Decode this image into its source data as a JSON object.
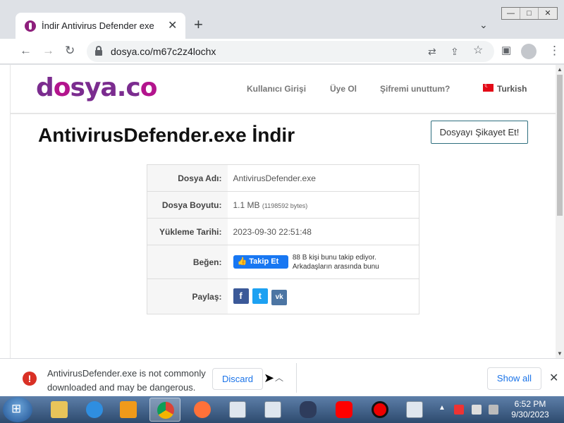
{
  "browser": {
    "tab_title": "İndir Antivirus Defender exe",
    "url": "dosya.co/m67c2z4lochx",
    "win_controls": {
      "minimize": "—",
      "maximize": "□",
      "close": "✕"
    }
  },
  "site": {
    "logo_prefix": "d",
    "logo_o": "o",
    "logo_mid": "sya.c",
    "logo_o2": "o",
    "nav": {
      "login": "Kullanıcı Girişi",
      "register": "Üye Ol",
      "forgot": "Şifremi unuttum?",
      "language": "Turkish"
    },
    "page_title": "AntivirusDefender.exe İndir",
    "report_button": "Dosyayı Şikayet Et!",
    "file_info": {
      "name_label": "Dosya Adı:",
      "name_value": "AntivirusDefender.exe",
      "size_label": "Dosya Boyutu:",
      "size_value": "1.1 MB",
      "size_bytes": "(1198592 bytes)",
      "date_label": "Yükleme Tarihi:",
      "date_value": "2023-09-30 22:51:48",
      "like_label": "Beğen:",
      "fb_button": "Takip Et",
      "fb_text_line1": "88 B kişi bunu takip ediyor.",
      "fb_text_line2": "Arkadaşların arasında bunu",
      "share_label": "Paylaş:",
      "share_icons": {
        "facebook": "f",
        "twitter": "t",
        "vk": "vk"
      }
    }
  },
  "download_bar": {
    "warning_line1": "AntivirusDefender.exe is not commonly",
    "warning_line2": "downloaded and may be dangerous.",
    "discard": "Discard",
    "show_all": "Show all"
  },
  "taskbar": {
    "time": "6:52 PM",
    "date": "9/30/2023"
  },
  "colors": {
    "brand_purple": "#7b2c8f",
    "facebook_blue": "#1877f2",
    "chrome_link_blue": "#1a73e8",
    "warning_red": "#d93025"
  }
}
